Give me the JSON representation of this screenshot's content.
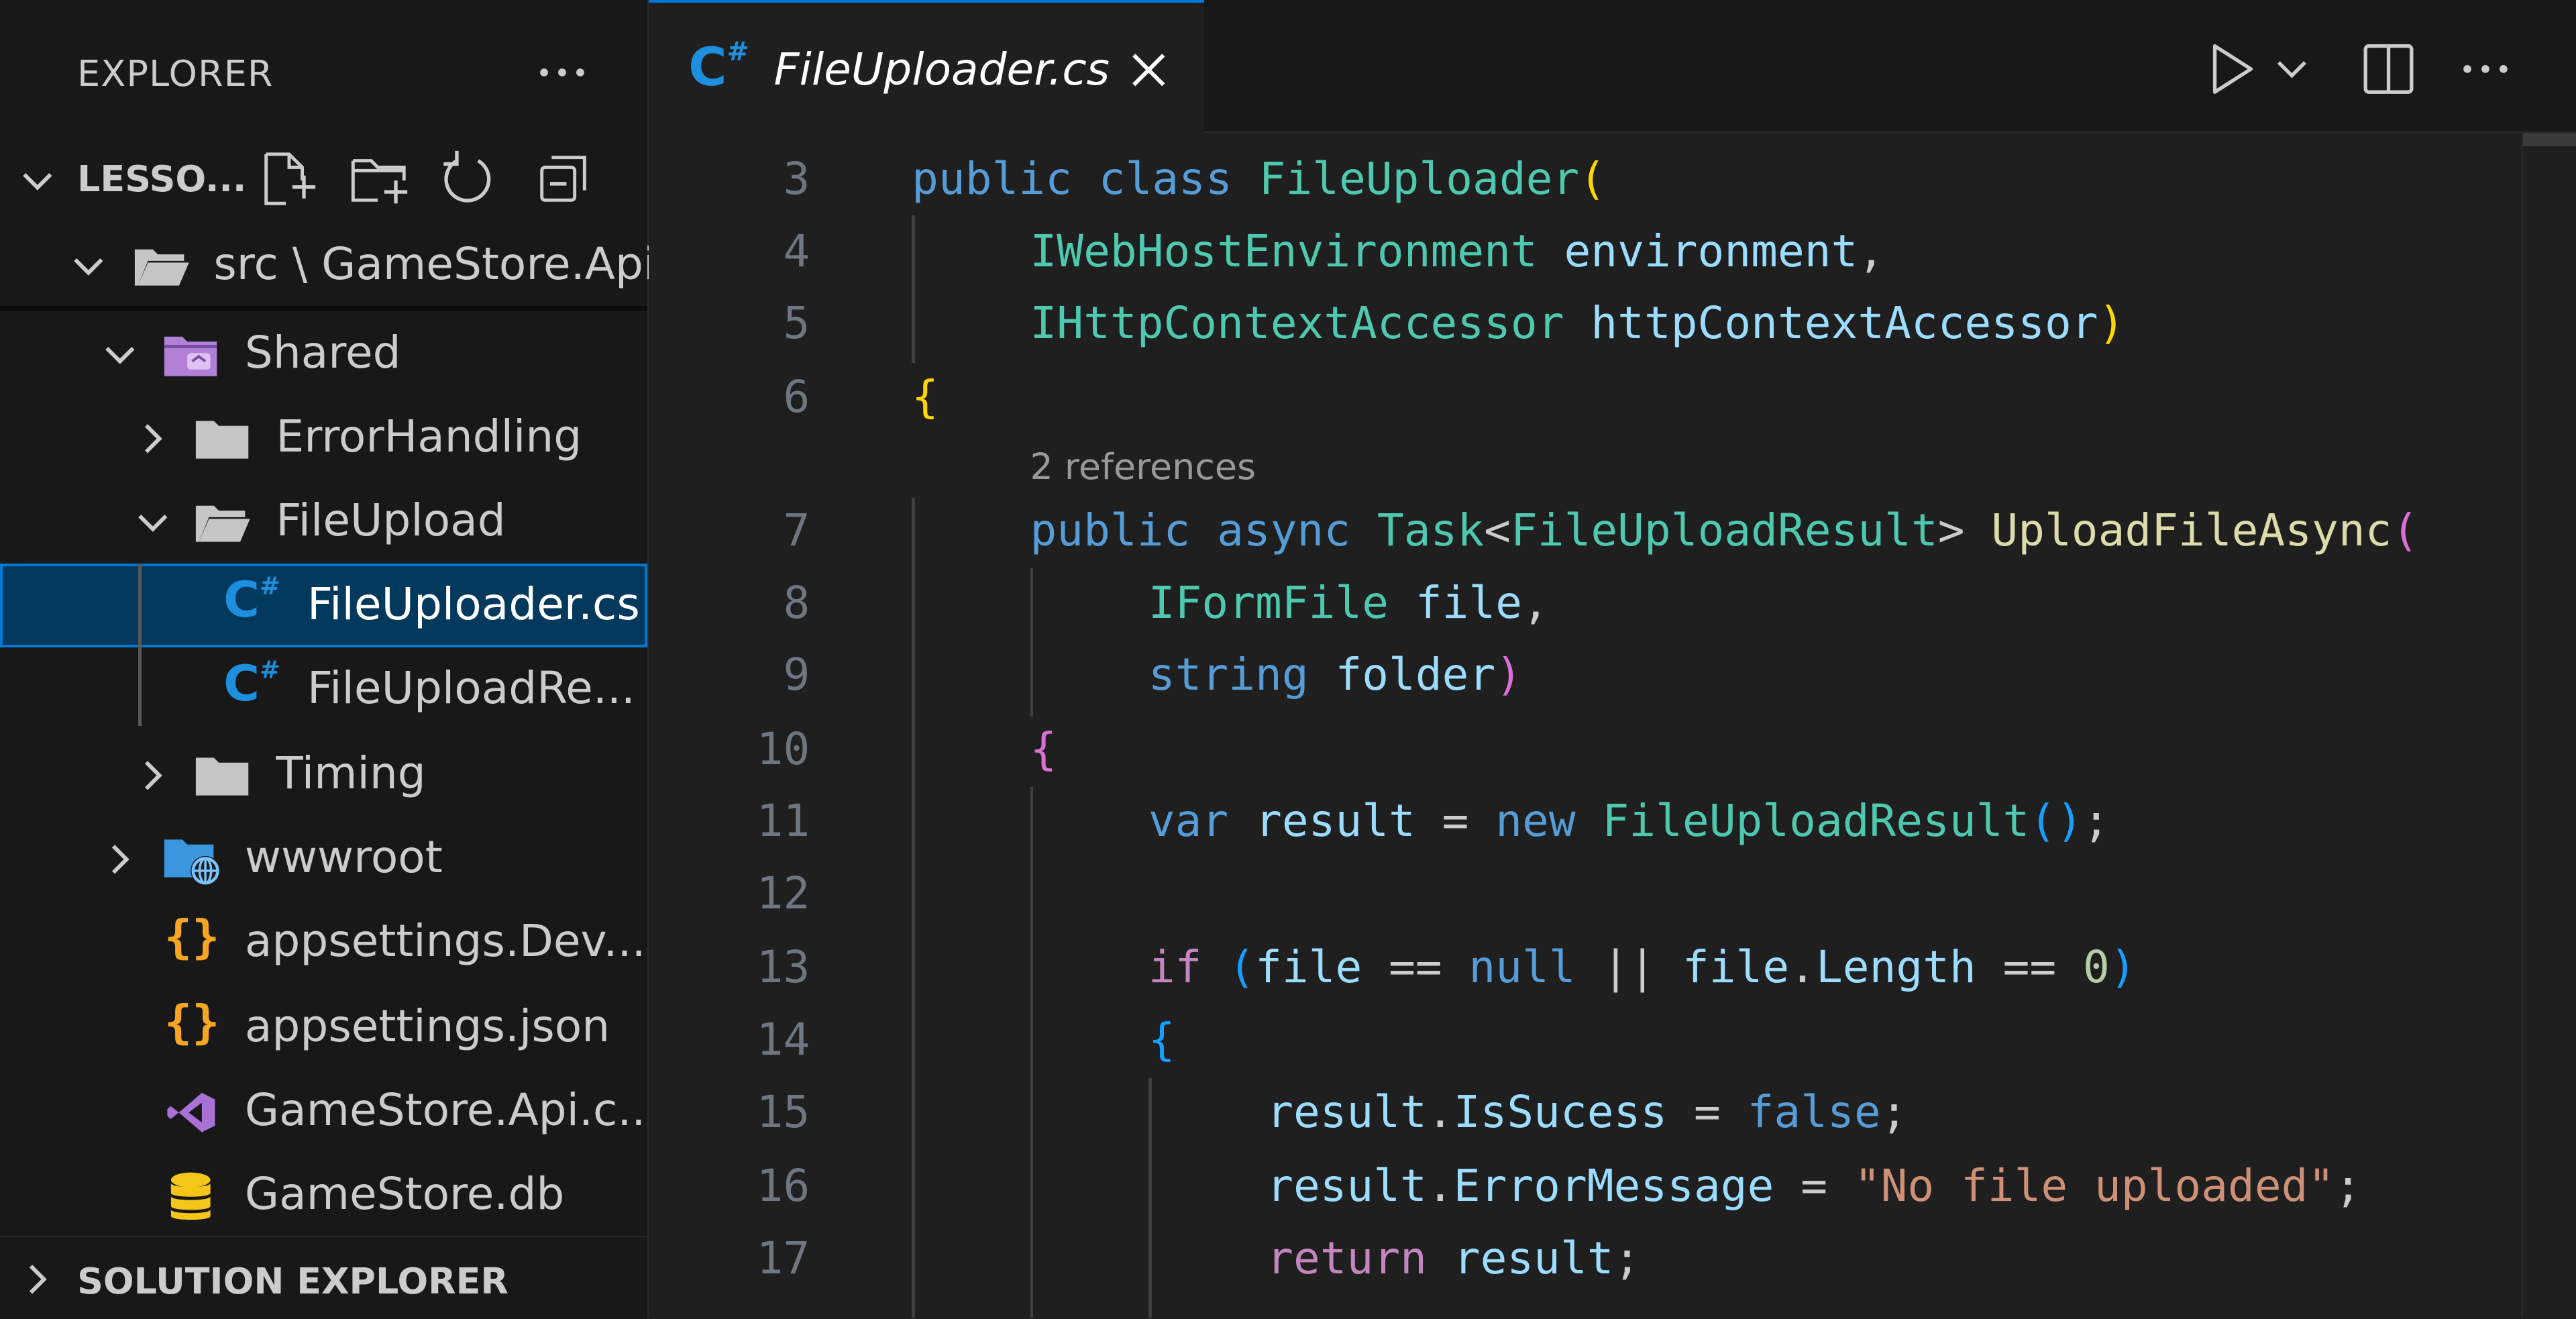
{
  "sidebar": {
    "title": "EXPLORER",
    "more_icon": "ellipsis-icon",
    "workspace_label": "LESSO...",
    "actions": [
      "new-file-icon",
      "new-folder-icon",
      "refresh-icon",
      "collapse-all-icon"
    ],
    "path_label": "src \\ GameStore.Api",
    "items": [
      {
        "label": "Shared",
        "icon": "special-folder-icon"
      },
      {
        "label": "ErrorHandling",
        "icon": "folder-icon"
      },
      {
        "label": "FileUpload",
        "icon": "folder-open-icon"
      },
      {
        "label": "FileUploader.cs",
        "icon": "csharp-icon"
      },
      {
        "label": "FileUploadRe...",
        "icon": "csharp-icon"
      },
      {
        "label": "Timing",
        "icon": "folder-icon"
      },
      {
        "label": "wwwroot",
        "icon": "globe-folder-icon"
      },
      {
        "label": "appsettings.Dev...",
        "icon": "json-icon"
      },
      {
        "label": "appsettings.json",
        "icon": "json-icon"
      },
      {
        "label": "GameStore.Api.c...",
        "icon": "visual-studio-icon"
      },
      {
        "label": "GameStore.db",
        "icon": "database-icon"
      }
    ],
    "solution_label": "SOLUTION EXPLORER"
  },
  "tabs": [
    {
      "label": "FileUploader.cs",
      "icon": "csharp-icon",
      "active": true
    }
  ],
  "editor": {
    "codelens": "2 references",
    "line_numbers": [
      "3",
      "4",
      "5",
      "6",
      "7",
      "8",
      "9",
      "10",
      "11",
      "12",
      "13",
      "14",
      "15",
      "16",
      "17"
    ]
  },
  "colors": {
    "accent": "#0078d4",
    "selection": "#04395e",
    "keyword": "#569cd6",
    "type": "#4ec9b0",
    "variable": "#9cdcfe",
    "function": "#dcdcaa",
    "control": "#c586c0",
    "string": "#ce9178"
  }
}
